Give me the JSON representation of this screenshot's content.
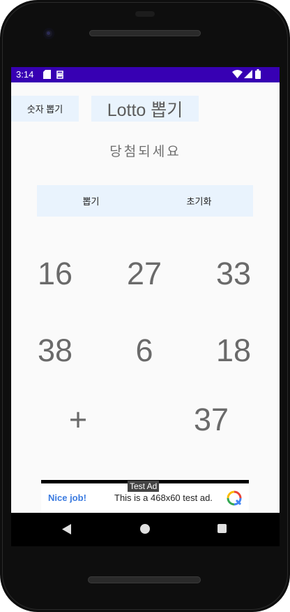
{
  "status_bar": {
    "time": "3:14",
    "icons": [
      "sd-card-icon",
      "sync-icon",
      "wifi-icon",
      "signal-icon",
      "battery-icon"
    ],
    "background": "#3700b3"
  },
  "header": {
    "pick_numbers_label": "숫자 뽑기",
    "title": "Lotto 뽑기"
  },
  "subtitle": "당첨되세요",
  "actions": {
    "draw_label": "뽑기",
    "reset_label": "초기화"
  },
  "numbers": {
    "row1": [
      "16",
      "27",
      "33"
    ],
    "row2": [
      "38",
      "6",
      "18"
    ],
    "bonus_separator": "+",
    "bonus": "37"
  },
  "ad": {
    "label": "Test Ad",
    "headline": "Nice job!",
    "body": "This is a 468x60 test ad."
  },
  "nav_bar": {
    "icons": [
      "back-icon",
      "home-icon",
      "recents-icon"
    ]
  },
  "colors": {
    "accent": "#3700b3",
    "button_background": "#e9f3fd",
    "number_text": "#6a6a6a"
  }
}
